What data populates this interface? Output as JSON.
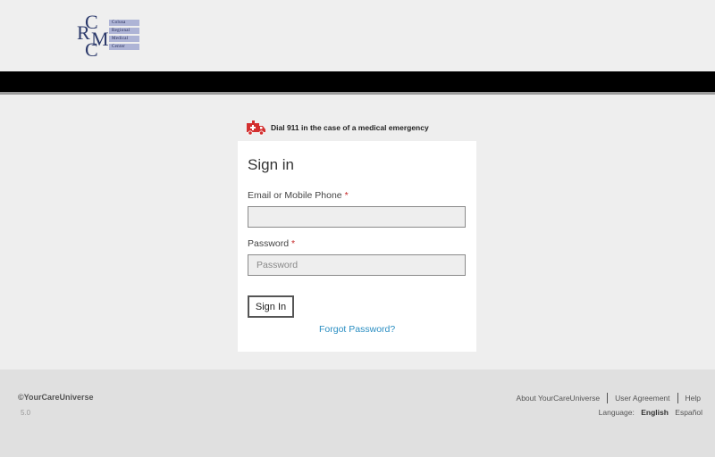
{
  "logo": {
    "letters": [
      "C",
      "R",
      "M",
      "C"
    ],
    "words": [
      "Colusa",
      "Regional",
      "Medical",
      "Center"
    ]
  },
  "notice": {
    "text": "Dial 911 in the case of a medical emergency",
    "icon": "ambulance-icon"
  },
  "signin": {
    "title": "Sign in",
    "email_label": "Email or Mobile Phone",
    "email_value": "",
    "email_placeholder": "",
    "password_label": "Password",
    "password_placeholder": "Password",
    "required_marker": "*",
    "submit_label": "Sign In",
    "forgot_label": "Forgot Password?"
  },
  "footer": {
    "copyright": "©YourCareUniverse",
    "version": "5.0",
    "links": [
      "About YourCareUniverse",
      "User Agreement",
      "Help"
    ],
    "language_label": "Language:",
    "languages": [
      "English",
      "Español"
    ],
    "active_language": "English"
  },
  "colors": {
    "link": "#2a8ec2",
    "required": "#c62828",
    "header_bar": "#000000",
    "notice_icon": "#d32f2f"
  }
}
